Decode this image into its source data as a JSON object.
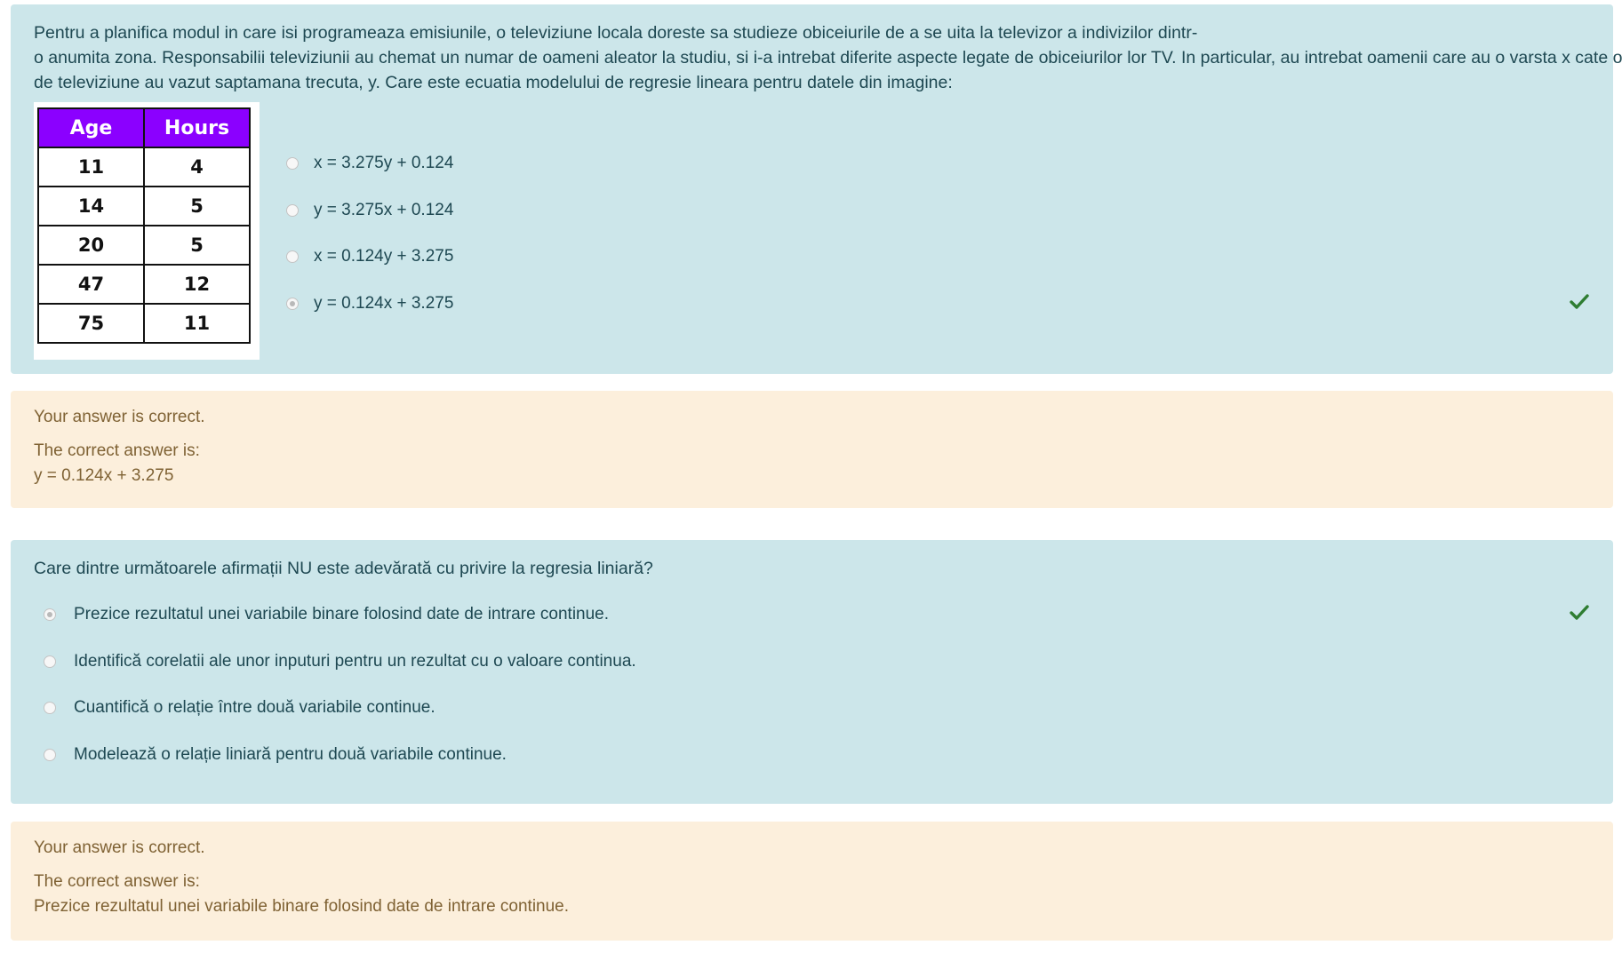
{
  "q1": {
    "lines": [
      "Pentru a planifica modul in care isi programeaza emisiunile, o televiziune locala doreste sa studieze obiceiurile de a se uita la televizor a indivizilor dintr-",
      "o anumita zona. Responsabilii televiziunii au chemat un numar de oameni aleator la studiu, si i-a intrebat diferite aspecte legate de obiceiurilor lor TV. In particular, au intrebat oamenii care au o varsta x cate ore",
      "de televiziune au vazut saptamana trecuta, y. Care este ecuatia modelului de regresie lineara pentru datele din imagine:"
    ],
    "table": {
      "headers": [
        "Age",
        "Hours"
      ],
      "rows": [
        [
          "11",
          "4"
        ],
        [
          "14",
          "5"
        ],
        [
          "20",
          "5"
        ],
        [
          "47",
          "12"
        ],
        [
          "75",
          "11"
        ]
      ]
    },
    "options": [
      "x = 3.275y + 0.124",
      "y = 3.275x + 0.124",
      "x = 0.124y + 3.275",
      "y = 0.124x + 3.275"
    ],
    "selected_index": 3,
    "check_icon": "check-icon",
    "check_color": "#2e7d32"
  },
  "fb1": {
    "status": "Your answer is correct.",
    "correct_label": "The correct answer is:",
    "correct_answer": "y = 0.124x + 3.275"
  },
  "q2": {
    "question": "Care dintre următoarele afirmații NU este adevărată cu privire la regresia liniară?",
    "options": [
      "Prezice rezultatul unei variabile binare folosind date de intrare continue.",
      "Identifică corelatii ale unor inputuri pentru un rezultat cu o valoare continua.",
      "Cuantifică o relație între două variabile continue.",
      "Modelează o relație liniară pentru două variabile continue."
    ],
    "selected_index": 0
  },
  "fb2": {
    "status": "Your answer is correct.",
    "correct_label": "The correct answer is:",
    "correct_answer": "Prezice rezultatul unei variabile binare folosind date de intrare continue."
  },
  "colors": {
    "question_bg": "#cce6ea",
    "feedback_bg": "#fcefdc",
    "table_header_bg": "#8b00ff"
  }
}
